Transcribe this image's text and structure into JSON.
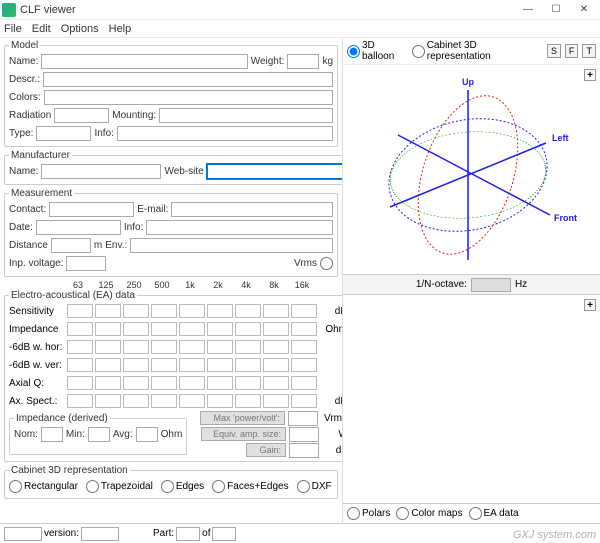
{
  "window": {
    "title": "CLF viewer"
  },
  "menu": {
    "file": "File",
    "edit": "Edit",
    "options": "Options",
    "help": "Help"
  },
  "model": {
    "legend": "Model",
    "name_lbl": "Name:",
    "name": "",
    "weight_lbl": "Weight:",
    "weight": "",
    "weight_unit": "kg",
    "descr_lbl": "Descr.:",
    "descr": "",
    "colors_lbl": "Colors:",
    "colors": "",
    "radiation_lbl": "Radiation",
    "radiation": "",
    "mounting_lbl": "Mounting:",
    "mounting": "",
    "type_lbl": "Type:",
    "type": "",
    "info_lbl": "Info:",
    "info": ""
  },
  "manufacturer": {
    "legend": "Manufacturer",
    "name_lbl": "Name:",
    "name": "",
    "website_lbl": "Web-site",
    "website": ""
  },
  "measurement": {
    "legend": "Measurement",
    "contact_lbl": "Contact:",
    "contact": "",
    "email_lbl": "E-mail:",
    "email": "",
    "date_lbl": "Date:",
    "date": "",
    "info_lbl": "Info:",
    "info": "",
    "distance_lbl": "Distance",
    "distance": "",
    "distance_unit": "m",
    "env_lbl": "Env.:",
    "env": "",
    "inpvolt_lbl": "Inp. voltage:",
    "inpvolt": "",
    "inpvolt_unit": "Vrms"
  },
  "freqs": [
    "63",
    "125",
    "250",
    "500",
    "1k",
    "2k",
    "4k",
    "8k",
    "16k"
  ],
  "ea": {
    "legend": "Electro-acoustical (EA) data",
    "rows": [
      {
        "label": "Sensitivity",
        "unit": "dB"
      },
      {
        "label": "Impedance",
        "unit": "Ohm"
      },
      {
        "label": "-6dB w. hor:",
        "unit": "°"
      },
      {
        "label": "-6dB w. ver:",
        "unit": "°"
      },
      {
        "label": "Axial Q:",
        "unit": ""
      },
      {
        "label": "Ax. Spect.:",
        "unit": "dB"
      }
    ],
    "impedance_legend": "Impedance (derived)",
    "nom_lbl": "Nom:",
    "min_lbl": "Min:",
    "avg_lbl": "Avg:",
    "ohm": "Ohm",
    "maxpower_btn": "Max 'power/volt':",
    "maxpower_unit": "Vrms",
    "equivamp_btn": "Equiv. amp. size:",
    "equivamp_unit": "W",
    "gain_btn": "Gain:",
    "gain_unit": "dB"
  },
  "cabinet": {
    "legend": "Cabinet 3D representation",
    "options": [
      "Rectangular",
      "Trapezoidal",
      "Edges",
      "Faces+Edges",
      "DXF"
    ]
  },
  "footer": {
    "version_lbl": "version:",
    "part_lbl": "Part:",
    "of_lbl": "of"
  },
  "right": {
    "balloon_lbl": "3D balloon",
    "cabinet_lbl": "Cabinet 3D representation",
    "sfbtns": [
      "S",
      "F",
      "T"
    ],
    "octave_lbl": "1/N-octave:",
    "hz_lbl": "Hz",
    "axis_up": "Up",
    "axis_left": "Left",
    "axis_front": "Front",
    "polars_lbl": "Polars",
    "colormaps_lbl": "Color maps",
    "eadata_lbl": "EA data"
  },
  "watermark": "GXJ system.com"
}
